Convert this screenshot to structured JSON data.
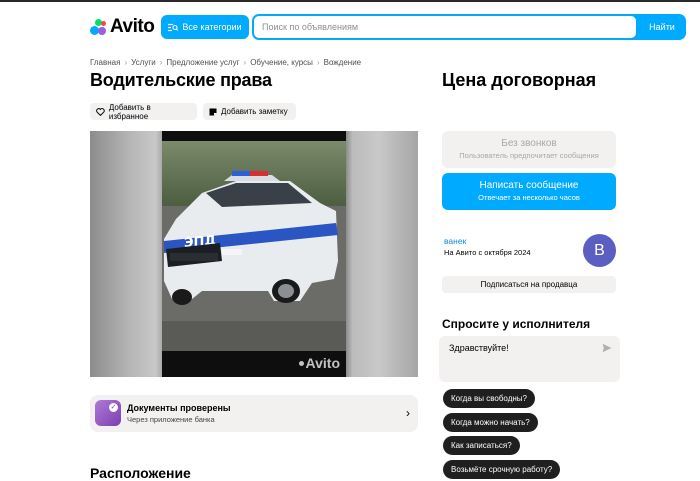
{
  "header": {
    "logo_text": "Avito",
    "categories_button": "Все категории",
    "search_placeholder": "Поиск по объявлениям",
    "search_button": "Найти"
  },
  "breadcrumb": [
    "Главная",
    "Услуги",
    "Предложение услуг",
    "Обучение, курсы",
    "Вождение"
  ],
  "listing": {
    "title": "Водительские права",
    "favorite_label": "Добавить в избранное",
    "note_label": "Добавить заметку",
    "photo_car_text": "ЭПД",
    "photo_watermark": "Avito"
  },
  "documents": {
    "title": "Документы проверены",
    "subtitle": "Через приложение банка"
  },
  "location_heading": "Расположение",
  "sidebar": {
    "price": "Цена договорная",
    "no_calls_title": "Без звонков",
    "no_calls_subtitle": "Пользователь предпочитает сообщения",
    "message_button": "Написать сообщение",
    "message_subtitle": "Отвечает за несколько часов",
    "seller_name": "ванек",
    "seller_since": "На Авито с октября 2024",
    "avatar_letter": "В",
    "subscribe_button": "Подписаться на продавца",
    "ask_title": "Спросите у исполнителя",
    "ask_text": "Здравствуйте!",
    "quick_questions": [
      "Когда вы свободны?",
      "Когда можно начать?",
      "Как записаться?",
      "Возьмёте срочную работу?"
    ]
  },
  "colors": {
    "accent": "#00aaff",
    "chip_bg": "#1f1f1f",
    "avatar_bg": "#5a5fc1",
    "seller_link": "#0a8cd6"
  }
}
